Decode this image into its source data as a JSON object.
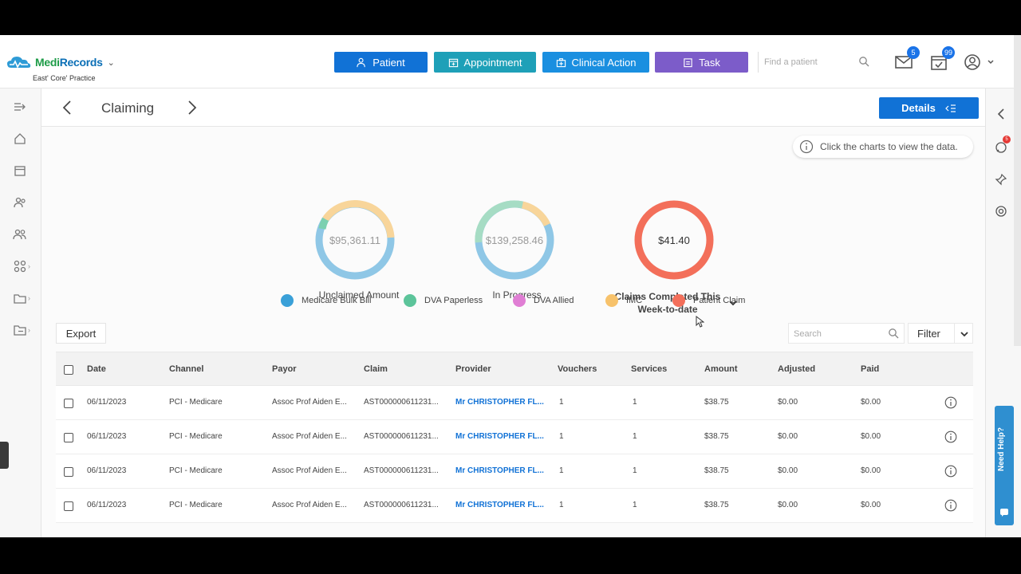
{
  "app": {
    "logo_part1": "Medi",
    "logo_part2": "Records",
    "practice": "East' Core' Practice"
  },
  "nav": {
    "patient": "Patient",
    "appointment": "Appointment",
    "clinical_action": "Clinical Action",
    "task": "Task",
    "find_placeholder": "Find a patient",
    "mail_count": "5",
    "tasks_count": "99",
    "notifications_count": "5"
  },
  "colors": {
    "patient": "#1172d6",
    "appointment": "#1ea0b8",
    "clinical": "#1a8fe0",
    "task": "#7c5cc9",
    "medicare": "#3aa0d8",
    "dva_paperless": "#5cc49a",
    "dva_allied": "#e07ed4",
    "imc": "#f7c26b",
    "patient_claim": "#f36f5a"
  },
  "page": {
    "title": "Claiming",
    "details_label": "Details",
    "hint": "Click the charts to view the data."
  },
  "summary": {
    "unclaimed_value": "$95,361.11",
    "unclaimed_label": "Unclaimed Amount",
    "inprogress_value": "$139,258.46",
    "inprogress_label": "In Progress",
    "completed_value": "$41.40",
    "completed_label_line1": "Claims Completed This",
    "completed_label_line2": "Week-to-date"
  },
  "legend": [
    {
      "label": "Medicare Bulk Bill",
      "color": "#3aa0d8"
    },
    {
      "label": "DVA Paperless",
      "color": "#5cc49a"
    },
    {
      "label": "DVA Allied",
      "color": "#e07ed4"
    },
    {
      "label": "IMC",
      "color": "#f7c26b"
    },
    {
      "label": "Patient Claim",
      "color": "#f36f5a"
    }
  ],
  "toolbar": {
    "export": "Export",
    "search_placeholder": "Search",
    "filter": "Filter"
  },
  "table": {
    "columns": [
      "Date",
      "Channel",
      "Payor",
      "Claim",
      "Provider",
      "Vouchers",
      "Services",
      "Amount",
      "Adjusted",
      "Paid"
    ],
    "rows": [
      [
        "06/11/2023",
        "PCI - Medicare",
        "Assoc Prof Aiden E...",
        "AST000000611231...",
        "Mr CHRISTOPHER FL...",
        "1",
        "1",
        "$38.75",
        "$0.00",
        "$0.00"
      ],
      [
        "06/11/2023",
        "PCI - Medicare",
        "Assoc Prof Aiden E...",
        "AST000000611231...",
        "Mr CHRISTOPHER FL...",
        "1",
        "1",
        "$38.75",
        "$0.00",
        "$0.00"
      ],
      [
        "06/11/2023",
        "PCI - Medicare",
        "Assoc Prof Aiden E...",
        "AST000000611231...",
        "Mr CHRISTOPHER FL...",
        "1",
        "1",
        "$38.75",
        "$0.00",
        "$0.00"
      ],
      [
        "06/11/2023",
        "PCI - Medicare",
        "Assoc Prof Aiden E...",
        "AST000000611231...",
        "Mr CHRISTOPHER FL...",
        "1",
        "1",
        "$38.75",
        "$0.00",
        "$0.00"
      ]
    ]
  },
  "side": {
    "need_help": "Need Help?"
  }
}
